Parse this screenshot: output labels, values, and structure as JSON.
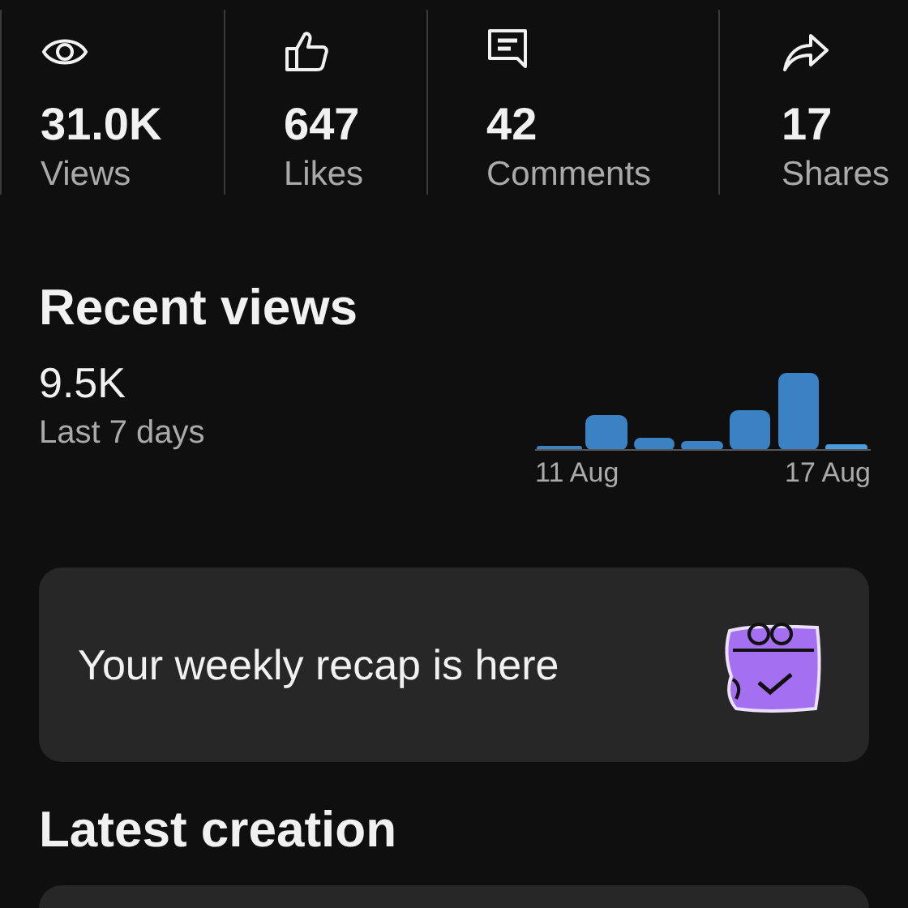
{
  "stats": [
    {
      "kind": "views",
      "value": "31.0K",
      "label": "Views"
    },
    {
      "kind": "likes",
      "value": "647",
      "label": "Likes"
    },
    {
      "kind": "comments",
      "value": "42",
      "label": "Comments"
    },
    {
      "kind": "shares",
      "value": "17",
      "label": "Shares"
    }
  ],
  "recent_views": {
    "title": "Recent views",
    "total": "9.5K",
    "period": "Last 7 days",
    "axis_labels": [
      "11 Aug",
      "17 Aug"
    ]
  },
  "recap_card": {
    "text": "Your weekly recap is here"
  },
  "latest_creation": {
    "title": "Latest creation"
  }
}
